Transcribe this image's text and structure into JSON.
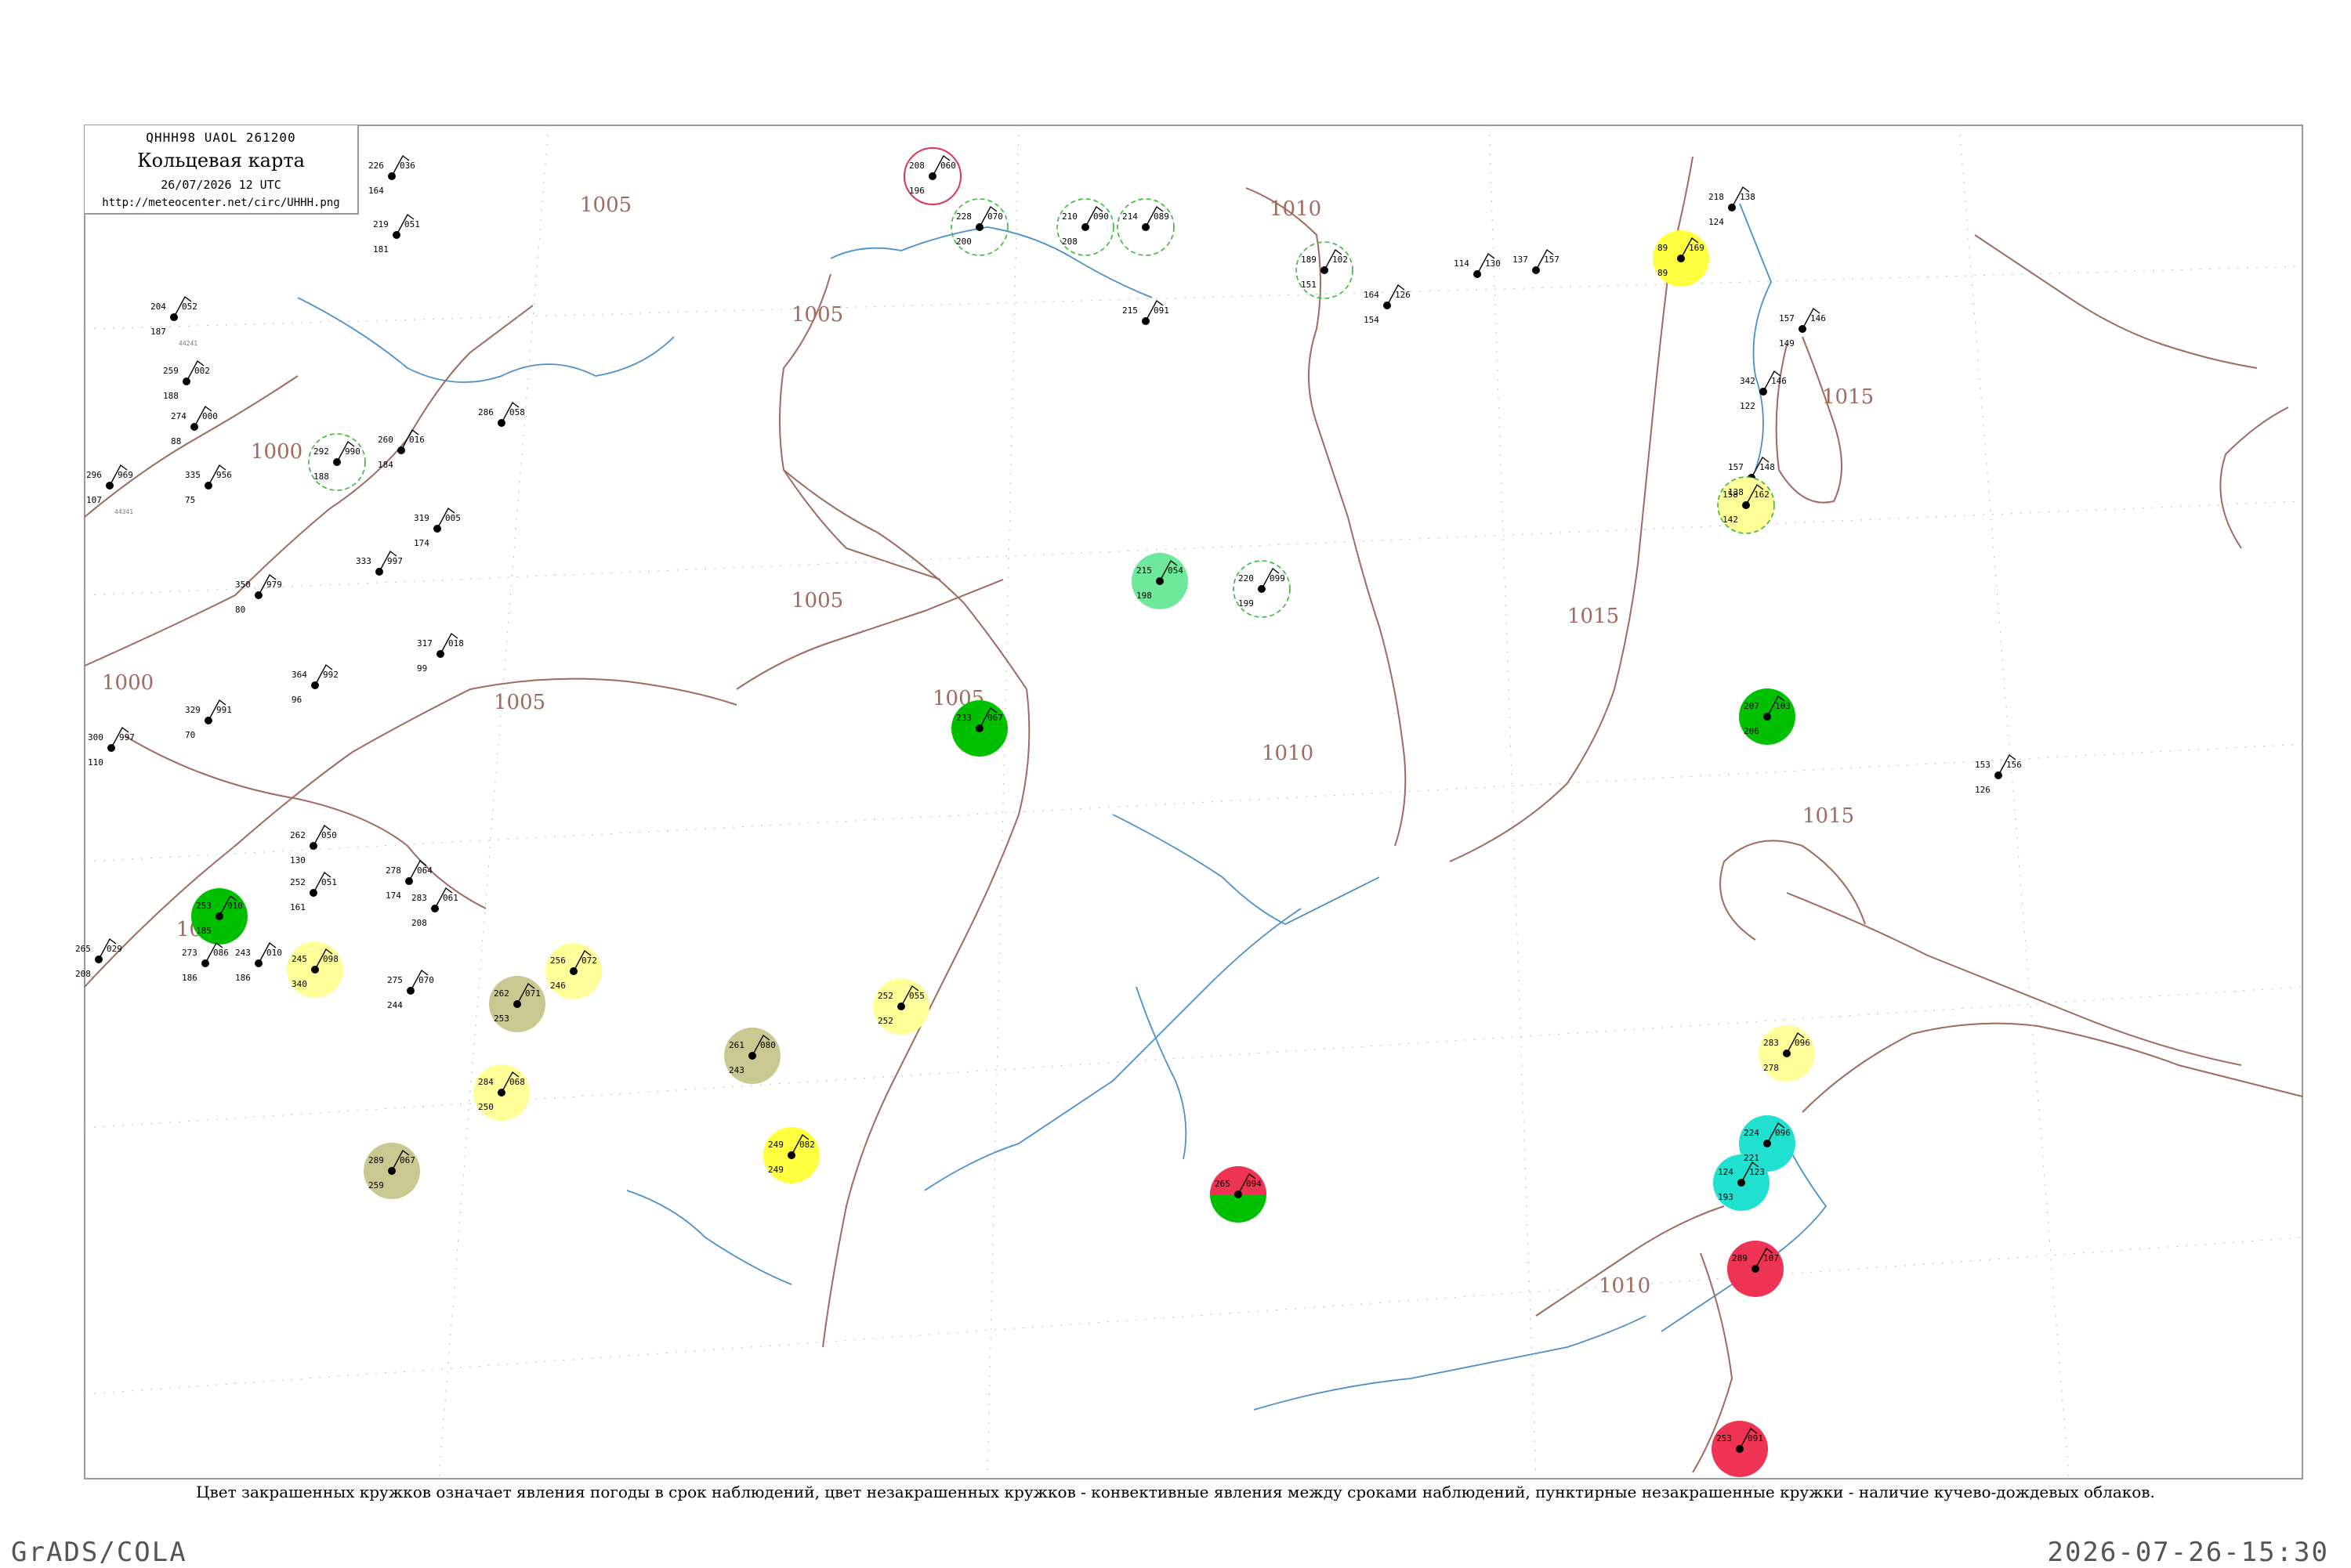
{
  "header": {
    "code_line": "QHHH98  UAOL  261200",
    "title": "Кольцевая карта",
    "datetime": "26/07/2026 12 UTC",
    "url": "http://meteocenter.net/circ/UHHH.png"
  },
  "caption": "Цвет закрашенных кружков означает явления погоды в срок наблюдений, цвет незакрашенных кружков - конвективные явления между сроками наблюдений, пунктирные незакрашенные кружки - наличие кучево-дождевых облаков.",
  "footer": {
    "left": "GrADS/COLA",
    "right": "2026-07-26-15:30"
  },
  "colors": {
    "frame": "#999999",
    "isobar": "#a06a5c",
    "coast": "#4a90c8",
    "rain_green": "#00c000",
    "light_green": "#6ee89a",
    "yellow": "#ffff40",
    "pale_yellow": "#ffff99",
    "olive": "#c8c890",
    "red": "#ee3355",
    "cyan": "#20e0d0",
    "dashed_green": "#33bb33"
  },
  "isobars": [
    "1000",
    "1000",
    "1000",
    "1005",
    "1005",
    "1005",
    "1005",
    "1005",
    "1010",
    "1010",
    "1010",
    "1015",
    "1015",
    "1015"
  ],
  "stations": [
    {
      "t": "204",
      "d": "052",
      "p": "187",
      "id": "44241",
      "fill": "none"
    },
    {
      "t": "259",
      "d": "002",
      "p": "188",
      "id": "",
      "fill": "none"
    },
    {
      "t": "274",
      "d": "000",
      "p": "88",
      "id": "",
      "fill": "none"
    },
    {
      "t": "296",
      "d": "969",
      "p": "107",
      "id": "44341",
      "fill": "none"
    },
    {
      "t": "335",
      "d": "956",
      "p": "75",
      "id": "",
      "fill": "none"
    },
    {
      "t": "350",
      "d": "979",
      "p": "80",
      "id": "",
      "fill": "none"
    },
    {
      "t": "226",
      "d": "036",
      "p": "164",
      "id": "",
      "fill": "none"
    },
    {
      "t": "219",
      "d": "051",
      "p": "181",
      "id": "",
      "fill": "none"
    },
    {
      "t": "260",
      "d": "016",
      "p": "184",
      "id": "",
      "fill": "none"
    },
    {
      "t": "292",
      "d": "990",
      "p": "188",
      "id": "",
      "fill": "dashed"
    },
    {
      "t": "319",
      "d": "005",
      "p": "174",
      "id": "",
      "fill": "none"
    },
    {
      "t": "333",
      "d": "997",
      "p": "",
      "id": "",
      "fill": "none"
    },
    {
      "t": "317",
      "d": "018",
      "p": "99",
      "id": "",
      "fill": "none"
    },
    {
      "t": "364",
      "d": "992",
      "p": "96",
      "id": "",
      "fill": "none"
    },
    {
      "t": "329",
      "d": "991",
      "p": "70",
      "id": "",
      "fill": "none"
    },
    {
      "t": "300",
      "d": "997",
      "p": "110",
      "id": "",
      "fill": "none"
    },
    {
      "t": "253",
      "d": "010",
      "p": "185",
      "id": "",
      "fill": "green"
    },
    {
      "t": "243",
      "d": "010",
      "p": "186",
      "id": "",
      "fill": "none"
    },
    {
      "t": "262",
      "d": "050",
      "p": "130",
      "id": "",
      "fill": "none"
    },
    {
      "t": "252",
      "d": "051",
      "p": "161",
      "id": "",
      "fill": "none"
    },
    {
      "t": "273",
      "d": "086",
      "p": "186",
      "id": "",
      "fill": "none"
    },
    {
      "t": "245",
      "d": "098",
      "p": "340",
      "id": "",
      "fill": "pale_yellow"
    },
    {
      "t": "265",
      "d": "029",
      "p": "208",
      "id": "",
      "fill": "none"
    },
    {
      "t": "275",
      "d": "070",
      "p": "244",
      "id": "",
      "fill": "none"
    },
    {
      "t": "278",
      "d": "064",
      "p": "174",
      "id": "",
      "fill": "none"
    },
    {
      "t": "283",
      "d": "061",
      "p": "208",
      "id": "",
      "fill": "none"
    },
    {
      "t": "262",
      "d": "071",
      "p": "253",
      "id": "",
      "fill": "olive"
    },
    {
      "t": "256",
      "d": "072",
      "p": "246",
      "id": "",
      "fill": "pale_yellow"
    },
    {
      "t": "261",
      "d": "080",
      "p": "243",
      "id": "",
      "fill": "olive"
    },
    {
      "t": "284",
      "d": "068",
      "p": "250",
      "id": "",
      "fill": "pale_yellow"
    },
    {
      "t": "289",
      "d": "067",
      "p": "259",
      "id": "",
      "fill": "olive"
    },
    {
      "t": "249",
      "d": "082",
      "p": "249",
      "id": "",
      "fill": "yellow"
    },
    {
      "t": "286",
      "d": "058",
      "p": "",
      "id": "",
      "fill": "none"
    },
    {
      "t": "252",
      "d": "055",
      "p": "252",
      "id": "",
      "fill": "pale_yellow"
    },
    {
      "t": "233",
      "d": "067",
      "p": "",
      "id": "",
      "fill": "green"
    },
    {
      "t": "215",
      "d": "054",
      "p": "198",
      "id": "",
      "fill": "light_green"
    },
    {
      "t": "220",
      "d": "099",
      "p": "199",
      "id": "",
      "fill": "dashed"
    },
    {
      "t": "208",
      "d": "060",
      "p": "196",
      "id": "",
      "fill": "red_ring"
    },
    {
      "t": "228",
      "d": "070",
      "p": "200",
      "id": "",
      "fill": "dashed"
    },
    {
      "t": "210",
      "d": "090",
      "p": "208",
      "id": "",
      "fill": "dashed"
    },
    {
      "t": "214",
      "d": "089",
      "p": "",
      "id": "",
      "fill": "dashed"
    },
    {
      "t": "215",
      "d": "091",
      "p": "",
      "id": "",
      "fill": "none"
    },
    {
      "t": "189",
      "d": "102",
      "p": "151",
      "id": "",
      "fill": "dashed"
    },
    {
      "t": "164",
      "d": "126",
      "p": "154",
      "id": "",
      "fill": "none"
    },
    {
      "t": "114",
      "d": "130",
      "p": "",
      "id": "",
      "fill": "none"
    },
    {
      "t": "137",
      "d": "157",
      "p": "",
      "id": "",
      "fill": "none"
    },
    {
      "t": "218",
      "d": "138",
      "p": "124",
      "id": "",
      "fill": "none"
    },
    {
      "t": "89",
      "d": "169",
      "p": "89",
      "id": "",
      "fill": "yellow"
    },
    {
      "t": "157",
      "d": "146",
      "p": "149",
      "id": "",
      "fill": "none"
    },
    {
      "t": "342",
      "d": "146",
      "p": "122",
      "id": "",
      "fill": "none"
    },
    {
      "t": "157",
      "d": "148",
      "p": "138",
      "id": "",
      "fill": "none"
    },
    {
      "t": "158",
      "d": "162",
      "p": "142",
      "id": "",
      "fill": "pale_yellow_dashed"
    },
    {
      "t": "153",
      "d": "156",
      "p": "126",
      "id": "",
      "fill": "none"
    },
    {
      "t": "207",
      "d": "103",
      "p": "206",
      "id": "",
      "fill": "green"
    },
    {
      "t": "224",
      "d": "096",
      "p": "221",
      "id": "",
      "fill": "cyan"
    },
    {
      "t": "124",
      "d": "123",
      "p": "193",
      "id": "",
      "fill": "cyan"
    },
    {
      "t": "283",
      "d": "096",
      "p": "278",
      "id": "",
      "fill": "pale_yellow"
    },
    {
      "t": "253",
      "d": "091",
      "p": "",
      "id": "",
      "fill": "red"
    },
    {
      "t": "289",
      "d": "107",
      "p": "",
      "id": "",
      "fill": "red"
    },
    {
      "t": "265",
      "d": "094",
      "p": "",
      "id": "",
      "fill": "red_green"
    }
  ]
}
